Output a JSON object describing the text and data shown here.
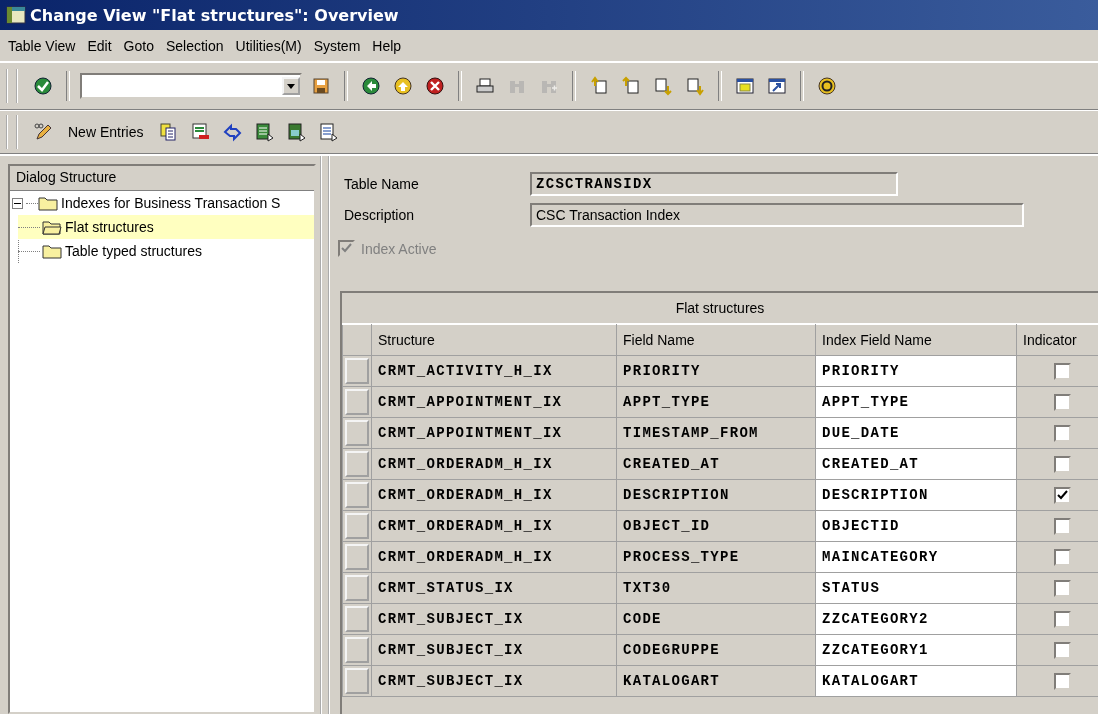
{
  "window": {
    "title": "Change View \"Flat structures\": Overview"
  },
  "menu": [
    {
      "label": "Table View"
    },
    {
      "label": "Edit"
    },
    {
      "label": "Goto"
    },
    {
      "label": "Selection"
    },
    {
      "label": "Utilities(M)"
    },
    {
      "label": "System"
    },
    {
      "label": "Help"
    }
  ],
  "standard_toolbar": [
    {
      "kind": "enter",
      "disabled": false
    },
    {
      "kind": "command"
    },
    {
      "kind": "save",
      "disabled": false
    },
    {
      "kind": "back",
      "disabled": false
    },
    {
      "kind": "exit",
      "disabled": false
    },
    {
      "kind": "cancel",
      "disabled": false
    },
    {
      "kind": "print",
      "disabled": false
    },
    {
      "kind": "find",
      "disabled": true
    },
    {
      "kind": "findnext",
      "disabled": true
    },
    {
      "kind": "first",
      "disabled": false
    },
    {
      "kind": "prev",
      "disabled": false
    },
    {
      "kind": "next",
      "disabled": false
    },
    {
      "kind": "last",
      "disabled": false
    },
    {
      "kind": "session",
      "disabled": false
    },
    {
      "kind": "shortcut",
      "disabled": false
    },
    {
      "kind": "help",
      "disabled": false
    }
  ],
  "app_toolbar": [
    {
      "kind": "edit"
    },
    {
      "kind": "text",
      "label": "New Entries"
    },
    {
      "kind": "copy"
    },
    {
      "kind": "delete"
    },
    {
      "kind": "undo"
    },
    {
      "kind": "selectall"
    },
    {
      "kind": "selectblock"
    },
    {
      "kind": "deselect"
    }
  ],
  "sidebar": {
    "title": "Dialog Structure",
    "items": [
      {
        "label": "Indexes for Business Transaction S",
        "expanded": true,
        "selected": false,
        "children": [
          {
            "label": "Flat structures",
            "selected": true
          },
          {
            "label": "Table typed structures",
            "selected": false
          }
        ]
      }
    ]
  },
  "form": {
    "table_name": {
      "label": "Table Name",
      "value": "ZCSCTRANSIDX"
    },
    "description": {
      "label": "Description",
      "value": "CSC Transaction Index"
    },
    "index_active": {
      "label": "Index Active",
      "checked": true,
      "disabled": true
    }
  },
  "table": {
    "title": "Flat structures",
    "columns": [
      "Structure",
      "Field Name",
      "Index Field Name",
      "Indicator"
    ],
    "rows": [
      {
        "structure": "CRMT_ACTIVITY_H_IX",
        "field_name": "PRIORITY",
        "index_field_name": "PRIORITY",
        "indicator": false
      },
      {
        "structure": "CRMT_APPOINTMENT_IX",
        "field_name": "APPT_TYPE",
        "index_field_name": "APPT_TYPE",
        "indicator": false
      },
      {
        "structure": "CRMT_APPOINTMENT_IX",
        "field_name": "TIMESTAMP_FROM",
        "index_field_name": "DUE_DATE",
        "indicator": false
      },
      {
        "structure": "CRMT_ORDERADM_H_IX",
        "field_name": "CREATED_AT",
        "index_field_name": "CREATED_AT",
        "indicator": false
      },
      {
        "structure": "CRMT_ORDERADM_H_IX",
        "field_name": "DESCRIPTION",
        "index_field_name": "DESCRIPTION",
        "indicator": true
      },
      {
        "structure": "CRMT_ORDERADM_H_IX",
        "field_name": "OBJECT_ID",
        "index_field_name": "OBJECTID",
        "indicator": false
      },
      {
        "structure": "CRMT_ORDERADM_H_IX",
        "field_name": "PROCESS_TYPE",
        "index_field_name": "MAINCATEGORY",
        "indicator": false
      },
      {
        "structure": "CRMT_STATUS_IX",
        "field_name": "TXT30",
        "index_field_name": "STATUS",
        "indicator": false
      },
      {
        "structure": "CRMT_SUBJECT_IX",
        "field_name": "CODE",
        "index_field_name": "ZZCATEGORY2",
        "indicator": false
      },
      {
        "structure": "CRMT_SUBJECT_IX",
        "field_name": "CODEGRUPPE",
        "index_field_name": "ZZCATEGORY1",
        "indicator": false
      },
      {
        "structure": "CRMT_SUBJECT_IX",
        "field_name": "KATALOGART",
        "index_field_name": "KATALOGART",
        "indicator": false
      }
    ]
  }
}
